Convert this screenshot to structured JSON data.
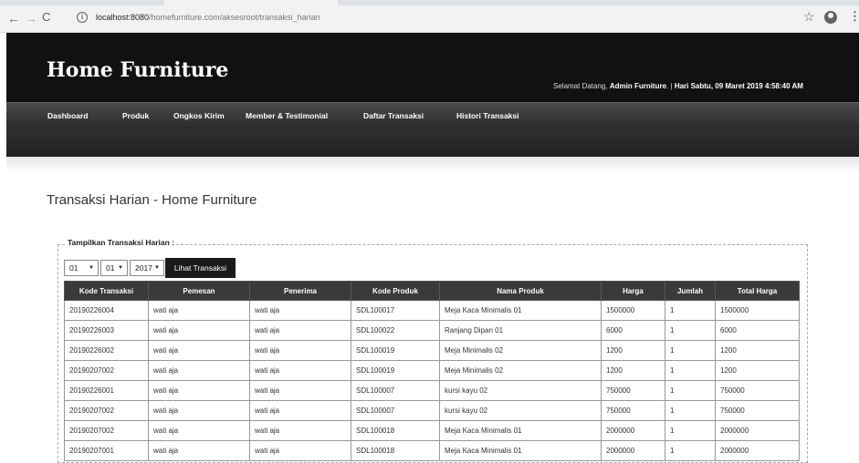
{
  "browser": {
    "url_host": "localhost:8080",
    "url_path": "/homefurniture.com/aksesroot/transaksi_harian"
  },
  "header": {
    "site_title": "Home Furniture",
    "welcome_prefix": "Selamat Datang,",
    "welcome_user": "Admin Furniture",
    "welcome_sep": "|",
    "welcome_date": "Hari Sabtu, 09 Maret 2019 4:58:40 AM"
  },
  "nav": {
    "items": [
      "Dashboard",
      "Produk",
      "Ongkos Kirim",
      "Member & Testimonial",
      "Daftar Transaksi",
      "Histori Transaksi"
    ]
  },
  "page": {
    "heading": "Transaksi Harian - Home Furniture",
    "fieldset_legend": "Tampilkan Transaksi Harian :",
    "day": "01",
    "month": "01",
    "year": "2017",
    "button_label": "Lihat Transaksi"
  },
  "table": {
    "headers": [
      "Kode Transaksi",
      "Pemesan",
      "Penerima",
      "Kode Produk",
      "Nama Produk",
      "Harga",
      "Jumlah",
      "Total Harga"
    ],
    "rows": [
      [
        "20190226004",
        "wati aja",
        "wati aja",
        "SDL100017",
        "Meja Kaca Minimalis 01",
        "1500000",
        "1",
        "1500000"
      ],
      [
        "20190226003",
        "wati aja",
        "wati aja",
        "SDL100022",
        "Ranjang Dipan 01",
        "6000",
        "1",
        "6000"
      ],
      [
        "20190226002",
        "wati aja",
        "wati aja",
        "SDL100019",
        "Meja Minimalis 02",
        "1200",
        "1",
        "1200"
      ],
      [
        "20190207002",
        "wati aja",
        "wati aja",
        "SDL100019",
        "Meja Minimalis 02",
        "1200",
        "1",
        "1200"
      ],
      [
        "20190226001",
        "wati aja",
        "wati aja",
        "SDL100007",
        "kursi kayu 02",
        "750000",
        "1",
        "750000"
      ],
      [
        "20190207002",
        "wati aja",
        "wati aja",
        "SDL100007",
        "kursi kayu 02",
        "750000",
        "1",
        "750000"
      ],
      [
        "20190207002",
        "wati aja",
        "wati aja",
        "SDL100018",
        "Meja Kaca Minimalis 01",
        "2000000",
        "1",
        "2000000"
      ],
      [
        "20190207001",
        "wati aja",
        "wati aja",
        "SDL100018",
        "Meja Kaca Minimalis 01",
        "2000000",
        "1",
        "2000000"
      ]
    ]
  },
  "icons": {
    "back": "arrow-left",
    "forward": "arrow-right",
    "reload": "reload",
    "info": "info-circle",
    "bookmark": "star",
    "account": "account-circle",
    "menu": "vertical-dots"
  }
}
